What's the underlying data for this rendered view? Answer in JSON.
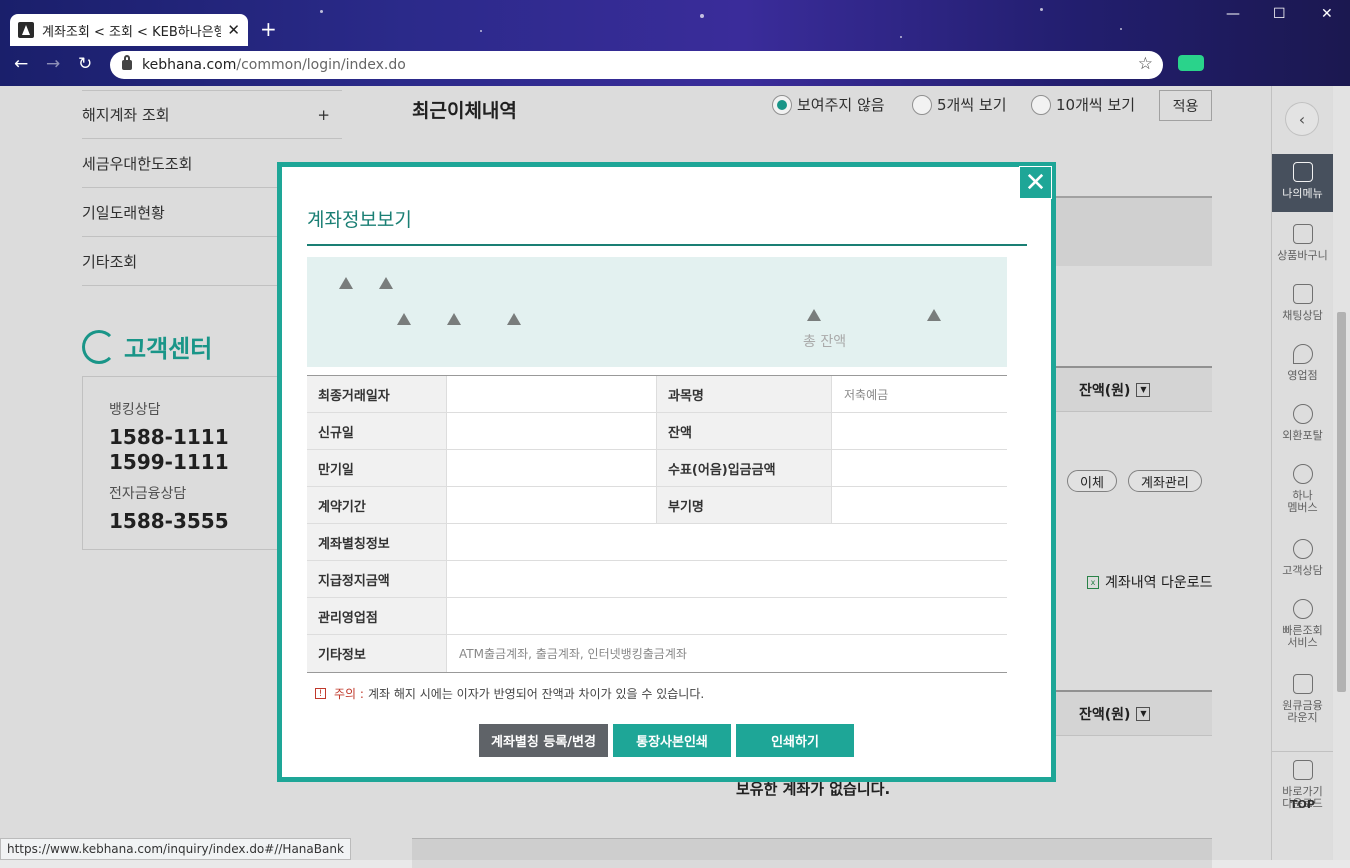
{
  "browser": {
    "tab_title": "계좌조회 < 조회 < KEB하나은행",
    "url_host": "kebhana.com",
    "url_path": "/common/login/index.do",
    "status_url": "https://www.kebhana.com/inquiry/index.do#//HanaBank"
  },
  "left_menu": {
    "items": [
      {
        "label": "해지계좌 조회",
        "expand": "+"
      },
      {
        "label": "세금우대한도조회",
        "expand": ""
      },
      {
        "label": "기일도래현황",
        "expand": ""
      },
      {
        "label": "기타조회",
        "expand": ""
      }
    ]
  },
  "customer_center": {
    "title": "고객센터",
    "banking_label": "뱅킹상담",
    "banking_numbers": [
      "1588-1111",
      "1599-1111"
    ],
    "efinance_label": "전자금융상담",
    "efinance_number": "1588-3555"
  },
  "main": {
    "recent_title": "최근이체내역",
    "radio_options": [
      {
        "label": "보여주지 않음",
        "selected": true
      },
      {
        "label": "5개씩 보기",
        "selected": false
      },
      {
        "label": "10개씩 보기",
        "selected": false
      }
    ],
    "apply_label": "적용",
    "balance_header": "잔액(원)",
    "transfer_label": "이체",
    "manage_label": "계좌관리",
    "download_label": "계좌내역 다운로드",
    "no_account_text": "보유한 계좌가 없습니다."
  },
  "right_sidebar": {
    "items": [
      {
        "label": "나의메뉴",
        "active": true
      },
      {
        "label": "상품바구니",
        "active": false
      },
      {
        "label": "채팅상담",
        "active": false
      },
      {
        "label": "영업점",
        "active": false
      },
      {
        "label": "외환포탈",
        "active": false
      },
      {
        "label": "하나\n멤버스",
        "active": false
      },
      {
        "label": "고객상담",
        "active": false
      },
      {
        "label": "빠른조회\n서비스",
        "active": false
      },
      {
        "label": "원큐금융\n라운지",
        "active": false
      },
      {
        "label": "바로가기\n다운로드",
        "active": false
      }
    ],
    "top_label": "TOP"
  },
  "modal": {
    "title": "계좌정보보기",
    "total_balance_label": "총 잔액",
    "table": {
      "last_trade_date": "최종거래일자",
      "product_name": "과목명",
      "product_value": "저축예금",
      "open_date": "신규일",
      "balance": "잔액",
      "maturity_date": "만기일",
      "check_deposit": "수표(어음)입금금액",
      "contract_period": "계약기간",
      "sub_name": "부기명",
      "alias_info": "계좌별칭정보",
      "stop_amount": "지급정지금액",
      "branch": "관리영업점",
      "etc_info": "기타정보",
      "etc_value": "ATM출금계좌, 출금계좌, 인터넷뱅킹출금계좌"
    },
    "note_warn": "주의 :",
    "note_text": "계좌 해지 시에는 이자가 반영되어 잔액과 차이가 있을 수 있습니다.",
    "btn_alias": "계좌별칭 등록/변경",
    "btn_passbook": "통장사본인쇄",
    "btn_print": "인쇄하기"
  }
}
